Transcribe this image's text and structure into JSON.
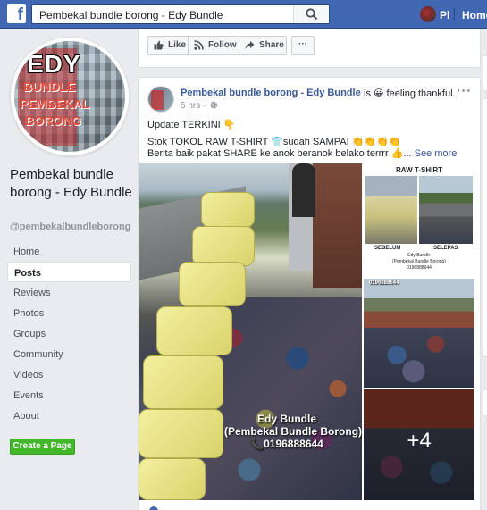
{
  "topbar": {
    "logo": "f",
    "search_value": "Pembekal bundle borong - Edy Bundle",
    "user_name": "Pl",
    "home_label": "Home"
  },
  "profile": {
    "logo_lines": [
      "EDY",
      "BUNDLE",
      "PEMBEKAL",
      "BORONG"
    ],
    "page_name": "Pembekal bundle borong - Edy Bundle",
    "handle": "@pembekalbundleborong"
  },
  "nav": {
    "items": [
      {
        "label": "Home",
        "active": false
      },
      {
        "label": "Posts",
        "active": true
      },
      {
        "label": "Reviews",
        "active": false
      },
      {
        "label": "Photos",
        "active": false
      },
      {
        "label": "Groups",
        "active": false
      },
      {
        "label": "Community",
        "active": false
      },
      {
        "label": "Videos",
        "active": false
      },
      {
        "label": "Events",
        "active": false
      },
      {
        "label": "About",
        "active": false
      }
    ],
    "create_page_label": "Create a Page"
  },
  "actions": {
    "like": "Like",
    "follow": "Follow",
    "share": "Share",
    "more": "···"
  },
  "post": {
    "author": "Pembekal bundle borong - Edy Bundle",
    "feeling": "is 😀 feeling thankful.",
    "time": "5 hrs ·",
    "more": "···",
    "line1": "Update TERKINI 👇",
    "line2": "Stok TOKOL RAW T-SHIRT 👕sudah SAMPAI 👏👏👏👏",
    "line3": "Berita baik pakat SHARE ke anok beranok belako terrrr 👍...",
    "see_more": "See more",
    "watermark_name": "Edy Bundle",
    "watermark_sub": "(Pembekal Bundle Borong)",
    "watermark_phone": "📞0196888644",
    "raw_title": "RAW T-SHIRT",
    "before_label": "SEBELUM",
    "after_label": "SELEPAS",
    "raw_caption": "Edy Bundle\n(Pembekal Bundle Borong)\n0196888644",
    "mr_watermark": "0196888644",
    "plus_count": "+4"
  },
  "colors": {
    "topbar": "#4267b2",
    "link": "#365899",
    "create_button": "#42b72a",
    "background": "#e9ebee"
  }
}
